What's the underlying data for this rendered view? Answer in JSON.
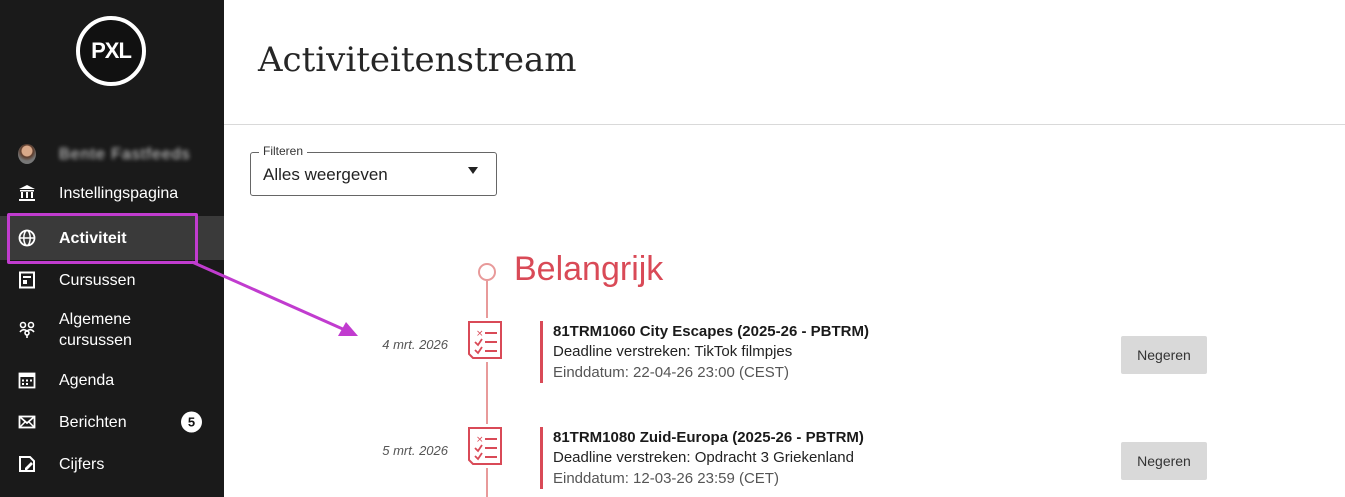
{
  "sidebar": {
    "logo_text": "PXL",
    "user_name": "Bente Fastfeeds",
    "items": [
      {
        "label": "Instellingspagina",
        "icon": "institution-icon"
      },
      {
        "label": "Activiteit",
        "icon": "globe-icon",
        "active": true
      },
      {
        "label": "Cursussen",
        "icon": "courses-icon"
      },
      {
        "label": "Algemene cursussen",
        "icon": "organizations-icon"
      },
      {
        "label": "Agenda",
        "icon": "calendar-icon"
      },
      {
        "label": "Berichten",
        "icon": "mail-icon",
        "badge": "5"
      },
      {
        "label": "Cijfers",
        "icon": "grades-icon"
      }
    ]
  },
  "header": {
    "title": "Activiteitenstream"
  },
  "filter": {
    "legend": "Filteren",
    "value": "Alles weergeven"
  },
  "stream": {
    "section_heading": "Belangrijk",
    "items": [
      {
        "date": "4 mrt. 2026",
        "course": "81TRM1060 City Escapes (2025-26 - PBTRM)",
        "description": "Deadline verstreken: TikTok filmpjes",
        "due": "Einddatum: 22-04-26 23:00 (CEST)",
        "button": "Negeren"
      },
      {
        "date": "5 mrt. 2026",
        "course": "81TRM1080 Zuid-Europa (2025-26 - PBTRM)",
        "description": "Deadline verstreken: Opdracht 3 Griekenland",
        "due": "Einddatum: 12-03-26 23:59 (CET)",
        "button": "Negeren"
      }
    ]
  },
  "colors": {
    "sidebar_bg": "#1a1a1a",
    "active_bg": "#3a3a3a",
    "highlight": "#c13ccf",
    "accent_red": "#d94a57",
    "timeline": "#e89a9a"
  }
}
